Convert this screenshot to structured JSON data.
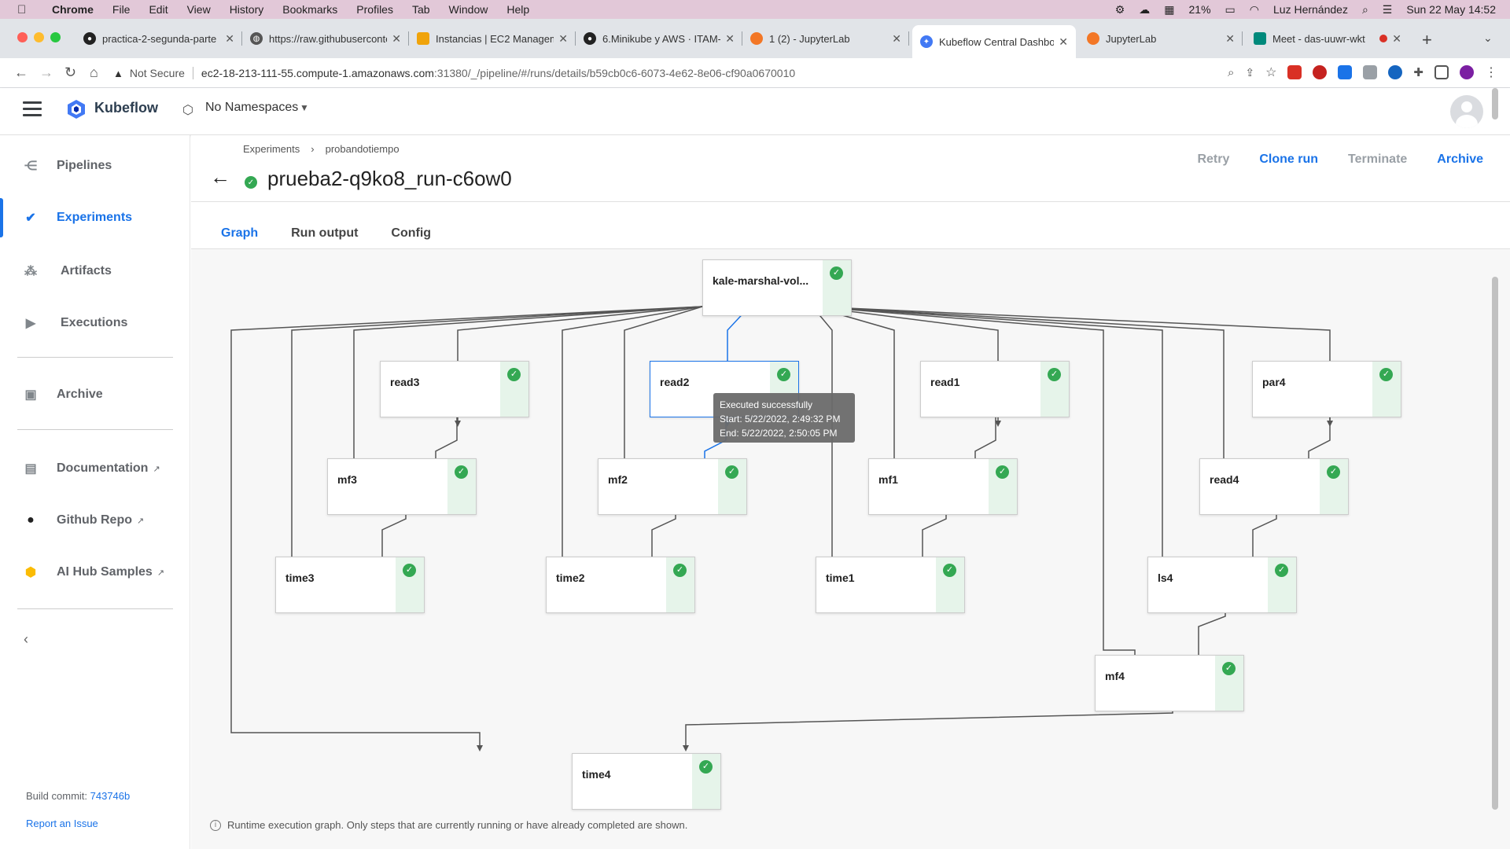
{
  "os_menubar": {
    "app": "Chrome",
    "items": [
      "File",
      "Edit",
      "View",
      "History",
      "Bookmarks",
      "Profiles",
      "Tab",
      "Window",
      "Help"
    ],
    "battery": "21%",
    "user": "Luz Hernández",
    "datetime": "Sun 22 May  14:52"
  },
  "browser": {
    "tabs": [
      {
        "label": "practica-2-segunda-parte",
        "icon": "github-icon",
        "active": false
      },
      {
        "label": "https://raw.githubuserconte",
        "icon": "globe-icon",
        "active": false
      },
      {
        "label": "Instancias | EC2 Managem",
        "icon": "aws-icon",
        "active": false
      },
      {
        "label": "6.Minikube y AWS · ITAM-",
        "icon": "github-icon",
        "active": false
      },
      {
        "label": "1 (2) - JupyterLab",
        "icon": "jupyter-icon",
        "active": false
      },
      {
        "label": "Kubeflow Central Dashbo",
        "icon": "kubeflow-icon",
        "active": true
      },
      {
        "label": "JupyterLab",
        "icon": "jupyter-icon",
        "active": false
      },
      {
        "label": "Meet - das-uuwr-wkt",
        "icon": "meet-icon",
        "active": false
      }
    ],
    "not_secure": "Not Secure",
    "url_host": "ec2-18-213-111-55.compute-1.amazonaws.com",
    "url_path": ":31380/_/pipeline/#/runs/details/b59cb0c6-6073-4e62-8e06-cf90a0670010"
  },
  "kf_header": {
    "brand": "Kubeflow",
    "namespace": "No Namespaces"
  },
  "sidebar": {
    "items": [
      {
        "label": "Pipelines",
        "icon": "pipelines-icon",
        "active": false
      },
      {
        "label": "Experiments",
        "icon": "experiments-icon",
        "active": true
      },
      {
        "label": "Artifacts",
        "icon": "artifacts-icon",
        "active": false
      },
      {
        "label": "Executions",
        "icon": "executions-icon",
        "active": false
      },
      {
        "label": "Archive",
        "icon": "archive-icon",
        "active": false
      },
      {
        "label": "Documentation",
        "icon": "doc-icon",
        "active": false
      },
      {
        "label": "Github Repo",
        "icon": "github-icon",
        "active": false
      },
      {
        "label": "AI Hub Samples",
        "icon": "aihub-icon",
        "active": false
      }
    ],
    "build_label": "Build commit: ",
    "build_commit": "743746b",
    "report": "Report an Issue"
  },
  "run": {
    "breadcrumb": [
      "Experiments",
      "probandotiempo"
    ],
    "title": "prueba2-q9ko8_run-c6ow0",
    "actions": {
      "retry": "Retry",
      "clone": "Clone run",
      "terminate": "Terminate",
      "archive": "Archive"
    },
    "tabs": [
      "Graph",
      "Run output",
      "Config"
    ],
    "active_tab": "Graph"
  },
  "graph": {
    "nodes": {
      "root": "kale-marshal-vol...",
      "read3": "read3",
      "read2": "read2",
      "read1": "read1",
      "par4": "par4",
      "mf3": "mf3",
      "mf2": "mf2",
      "mf1": "mf1",
      "read4": "read4",
      "time3": "time3",
      "time2": "time2",
      "time1": "time1",
      "ls4": "ls4",
      "mf4": "mf4",
      "time4": "time4"
    },
    "tooltip": {
      "status": "Executed successfully",
      "start": "Start: 5/22/2022, 2:49:32 PM",
      "end": "End: 5/22/2022, 2:50:05 PM"
    },
    "note": "Runtime execution graph. Only steps that are currently running or have already completed are shown."
  },
  "colors": {
    "accent": "#1a73e8",
    "success": "#34a853"
  }
}
